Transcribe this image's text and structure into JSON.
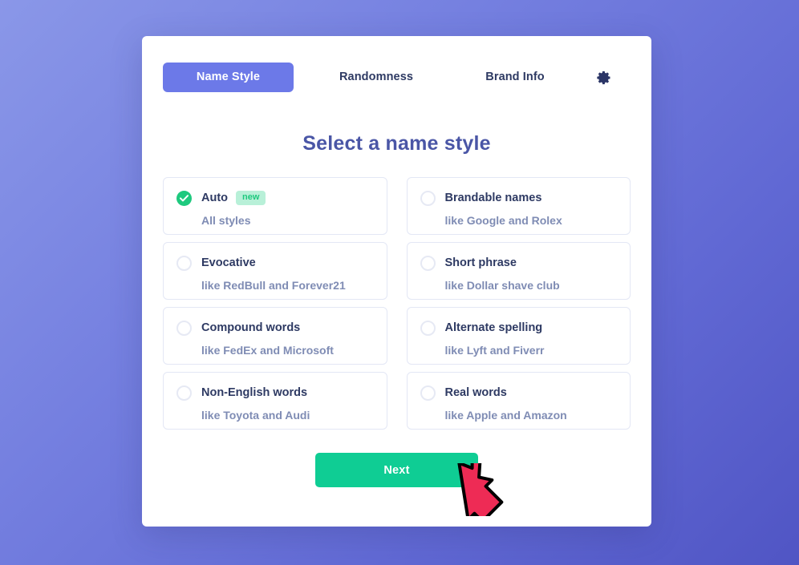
{
  "app": {
    "background_top_color": "#8a97e8",
    "background_bottom_color": "#5055c4"
  },
  "tabs": [
    {
      "label": "Name Style",
      "active": true
    },
    {
      "label": "Randomness",
      "active": false
    },
    {
      "label": "Brand Info",
      "active": false
    }
  ],
  "settings_icon": "gear-icon",
  "heading": "Select a name style",
  "options": [
    {
      "title": "Auto",
      "subtitle": "All styles",
      "selected": true,
      "badge": "new"
    },
    {
      "title": "Brandable names",
      "subtitle": "like Google and Rolex",
      "selected": false,
      "badge": ""
    },
    {
      "title": "Evocative",
      "subtitle": "like RedBull and Forever21",
      "selected": false,
      "badge": ""
    },
    {
      "title": "Short phrase",
      "subtitle": "like Dollar shave club",
      "selected": false,
      "badge": ""
    },
    {
      "title": "Compound words",
      "subtitle": "like FedEx and Microsoft",
      "selected": false,
      "badge": ""
    },
    {
      "title": "Alternate spelling",
      "subtitle": "like Lyft and Fiverr",
      "selected": false,
      "badge": ""
    },
    {
      "title": "Non-English words",
      "subtitle": "like Toyota and Audi",
      "selected": false,
      "badge": ""
    },
    {
      "title": "Real words",
      "subtitle": "like Apple and Amazon",
      "selected": false,
      "badge": ""
    }
  ],
  "footer": {
    "next_label": "Next",
    "next_color": "#0fcd94"
  },
  "cursor": {
    "type": "arrow-pointer",
    "color": "#ee2b55",
    "outline": "#000000"
  },
  "colors": {
    "accent_purple": "#6c79e8",
    "title_text": "#4a56a6",
    "option_title": "#2e3a63",
    "option_subtitle": "#7f8cb4",
    "check_green": "#1ec97e",
    "badge_bg": "#b8f0d8"
  }
}
